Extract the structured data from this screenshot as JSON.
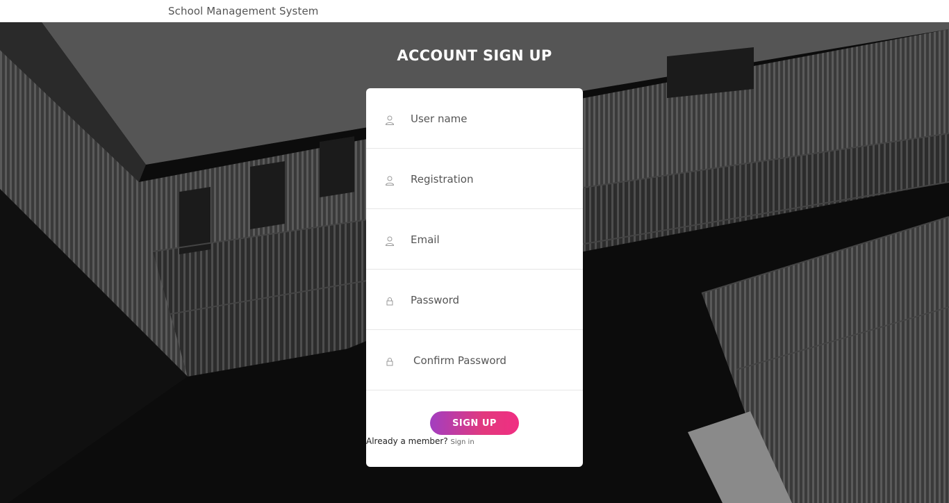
{
  "header": {
    "brand": "School Management System"
  },
  "page": {
    "title": "ACCOUNT SIGN UP"
  },
  "form": {
    "fields": [
      {
        "placeholder": "User name",
        "value": "",
        "icon": "user-icon"
      },
      {
        "placeholder": "Registration",
        "value": "",
        "icon": "user-icon"
      },
      {
        "placeholder": "Email",
        "value": "",
        "icon": "user-icon"
      },
      {
        "placeholder": "Password",
        "value": "",
        "icon": "lock-icon"
      },
      {
        "placeholder": "Confirm Password",
        "value": "",
        "icon": "lock-icon"
      }
    ],
    "submit_label": "SIGN UP",
    "member_text": "Already a member?",
    "signin_label": "Sign in"
  },
  "colors": {
    "button_gradient_start": "#a23ec0",
    "button_gradient_end": "#f02e82",
    "card_background": "#ffffff"
  }
}
